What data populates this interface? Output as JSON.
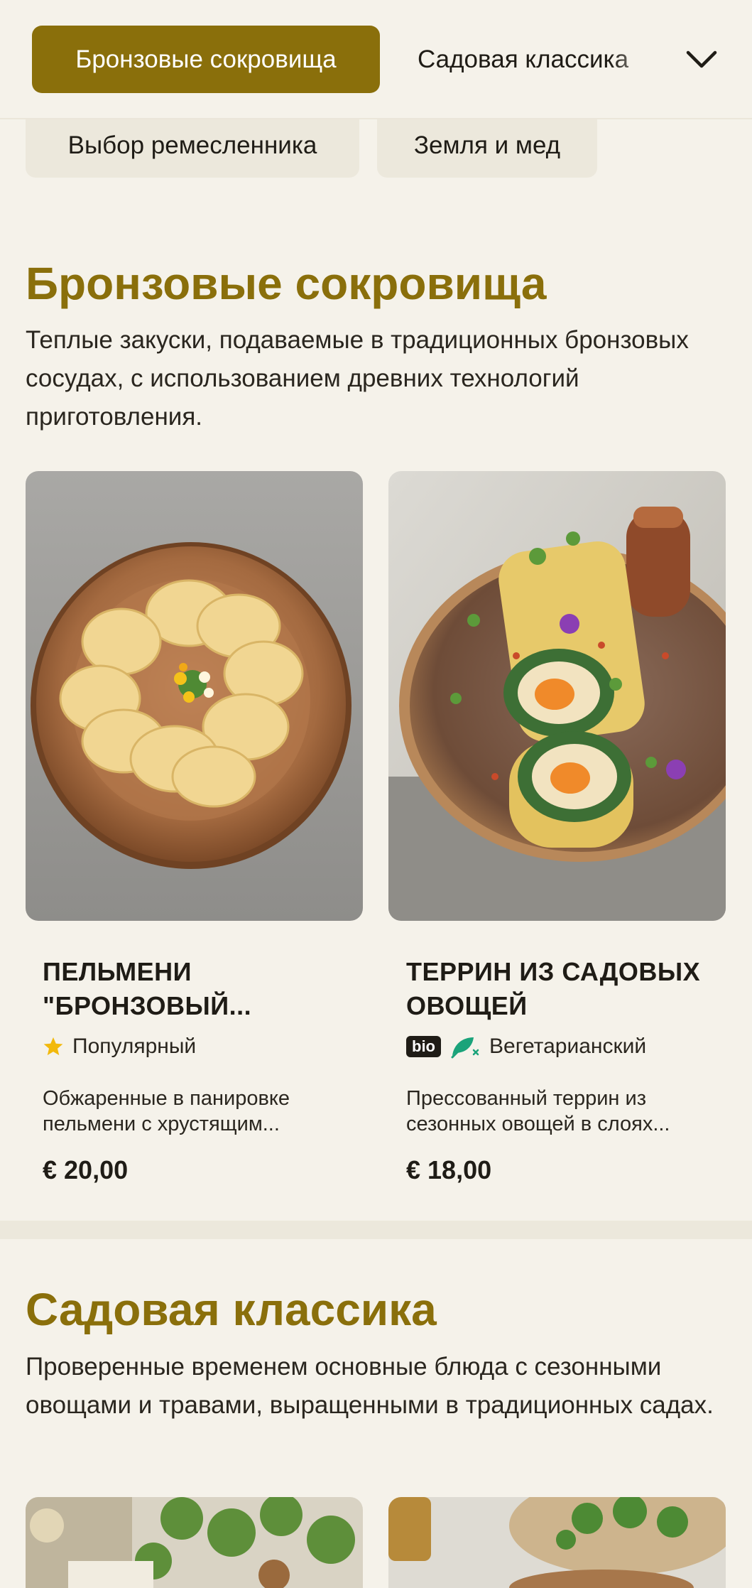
{
  "nav": {
    "active_chip": "Бронзовые сокровища",
    "next_chip": "Садовая классика",
    "row2_chips": [
      "Выбор ремесленника",
      "Земля и мед"
    ]
  },
  "sections": [
    {
      "title": "Бронзовые сокровища",
      "description": "Теплые закуски, подаваемые в традиционных бронзовых сосудах, с использованием древних технологий приготовления.",
      "items": [
        {
          "name": "ПЕЛЬМЕНИ \"БРОНЗОВЫЙ...",
          "tag_label": "Популярный",
          "description": "Обжаренные в панировке пельмени с хрустящим...",
          "price": "€ 20,00"
        },
        {
          "name": "ТЕРРИН ИЗ САДОВЫХ ОВОЩЕЙ",
          "badge": "bio",
          "tag_label": "Вегетарианский",
          "description": "Прессованный террин из сезонных овощей в слоях...",
          "price": "€ 18,00"
        }
      ]
    },
    {
      "title": "Садовая классика",
      "description": "Проверенные временем основные блюда с сезонными овощами и травами, выращенными в традиционных садах."
    }
  ],
  "icons": {
    "dropdown": "chevron-down-icon",
    "popular": "star-icon",
    "vegetarian": "leaf-icon"
  },
  "colors": {
    "accent": "#8a6f0b",
    "background": "#f5f2ea",
    "star": "#f2b90c",
    "leaf": "#1aa37a"
  }
}
